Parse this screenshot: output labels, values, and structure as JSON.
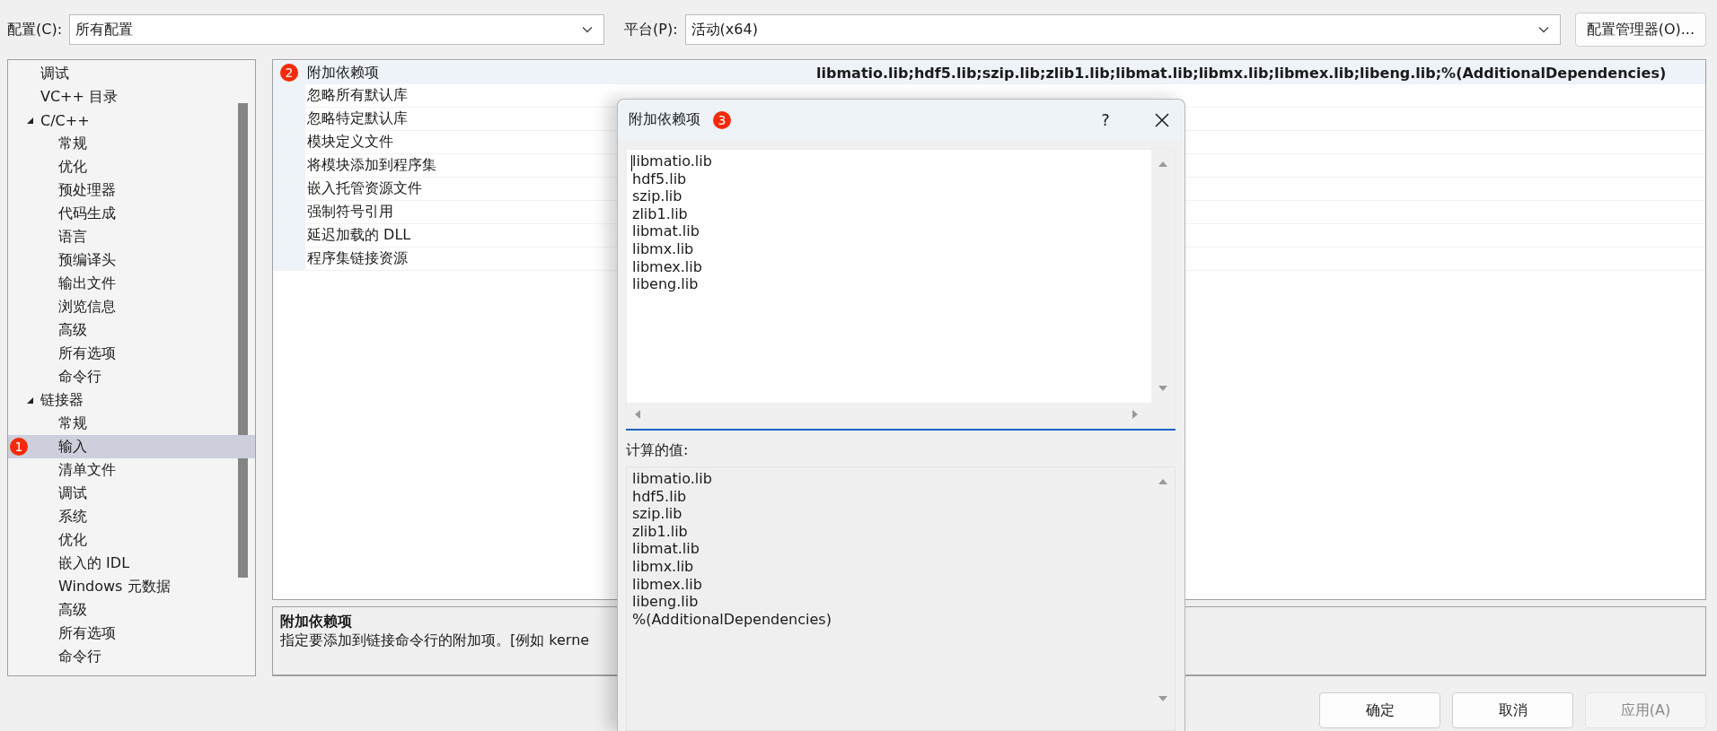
{
  "toolbar": {
    "configuration_label": "配置(C):",
    "configuration": "所有配置",
    "platform_label": "平台(P):",
    "platform": "活动(x64)",
    "manager_button": "配置管理器(O)..."
  },
  "tree": {
    "items": [
      {
        "label": "调试",
        "selected": false
      },
      {
        "label": "VC++ 目录",
        "selected": false
      },
      {
        "label": "C/C++",
        "selected": false,
        "expanded": true,
        "children": [
          {
            "label": "常规",
            "selected": false
          },
          {
            "label": "优化",
            "selected": false
          },
          {
            "label": "预处理器",
            "selected": false
          },
          {
            "label": "代码生成",
            "selected": false
          },
          {
            "label": "语言",
            "selected": false
          },
          {
            "label": "预编译头",
            "selected": false
          },
          {
            "label": "输出文件",
            "selected": false
          },
          {
            "label": "浏览信息",
            "selected": false
          },
          {
            "label": "高级",
            "selected": false
          },
          {
            "label": "所有选项",
            "selected": false
          },
          {
            "label": "命令行",
            "selected": false
          }
        ]
      },
      {
        "label": "链接器",
        "selected": false,
        "expanded": true,
        "children": [
          {
            "label": "常规",
            "selected": false
          },
          {
            "label": "输入",
            "selected": true,
            "badge": "1"
          },
          {
            "label": "清单文件",
            "selected": false
          },
          {
            "label": "调试",
            "selected": false
          },
          {
            "label": "系统",
            "selected": false
          },
          {
            "label": "优化",
            "selected": false
          },
          {
            "label": "嵌入的 IDL",
            "selected": false
          },
          {
            "label": "Windows 元数据",
            "selected": false
          },
          {
            "label": "高级",
            "selected": false
          },
          {
            "label": "所有选项",
            "selected": false
          },
          {
            "label": "命令行",
            "selected": false
          }
        ]
      }
    ]
  },
  "properties": {
    "rows": [
      {
        "name": "附加依赖项",
        "value": "libmatio.lib;hdf5.lib;szip.lib;zlib1.lib;libmat.lib;libmx.lib;libmex.lib;libeng.lib;%(AdditionalDependencies)",
        "selected": true,
        "badge": "2"
      },
      {
        "name": "忽略所有默认库",
        "selected": false
      },
      {
        "name": "忽略特定默认库",
        "selected": false
      },
      {
        "name": "模块定义文件",
        "selected": false
      },
      {
        "name": "将模块添加到程序集",
        "selected": false
      },
      {
        "name": "嵌入托管资源文件",
        "selected": false
      },
      {
        "name": "强制符号引用",
        "selected": false
      },
      {
        "name": "延迟加载的 DLL",
        "selected": false
      },
      {
        "name": "程序集链接资源",
        "selected": false
      }
    ]
  },
  "description": {
    "title": "附加依赖项",
    "text": "指定要添加到链接命令行的附加项。[例如 kerne"
  },
  "buttons": [
    {
      "label": "确定",
      "disabled": false
    },
    {
      "label": "取消",
      "disabled": false
    },
    {
      "label": "应用(A)",
      "disabled": true
    }
  ],
  "dialog": {
    "title": "附加依赖项",
    "badge": "3",
    "help_button": "?",
    "lines": [
      "libmatio.lib",
      "hdf5.lib",
      "szip.lib",
      "zlib1.lib",
      "libmat.lib",
      "libmx.lib",
      "libmex.lib",
      "libeng.lib"
    ],
    "computed_label": "计算的值:",
    "computed_lines": [
      "libmatio.lib",
      "hdf5.lib",
      "szip.lib",
      "zlib1.lib",
      "libmat.lib",
      "libmx.lib",
      "libmex.lib",
      "libeng.lib",
      "%(AdditionalDependencies)"
    ]
  }
}
